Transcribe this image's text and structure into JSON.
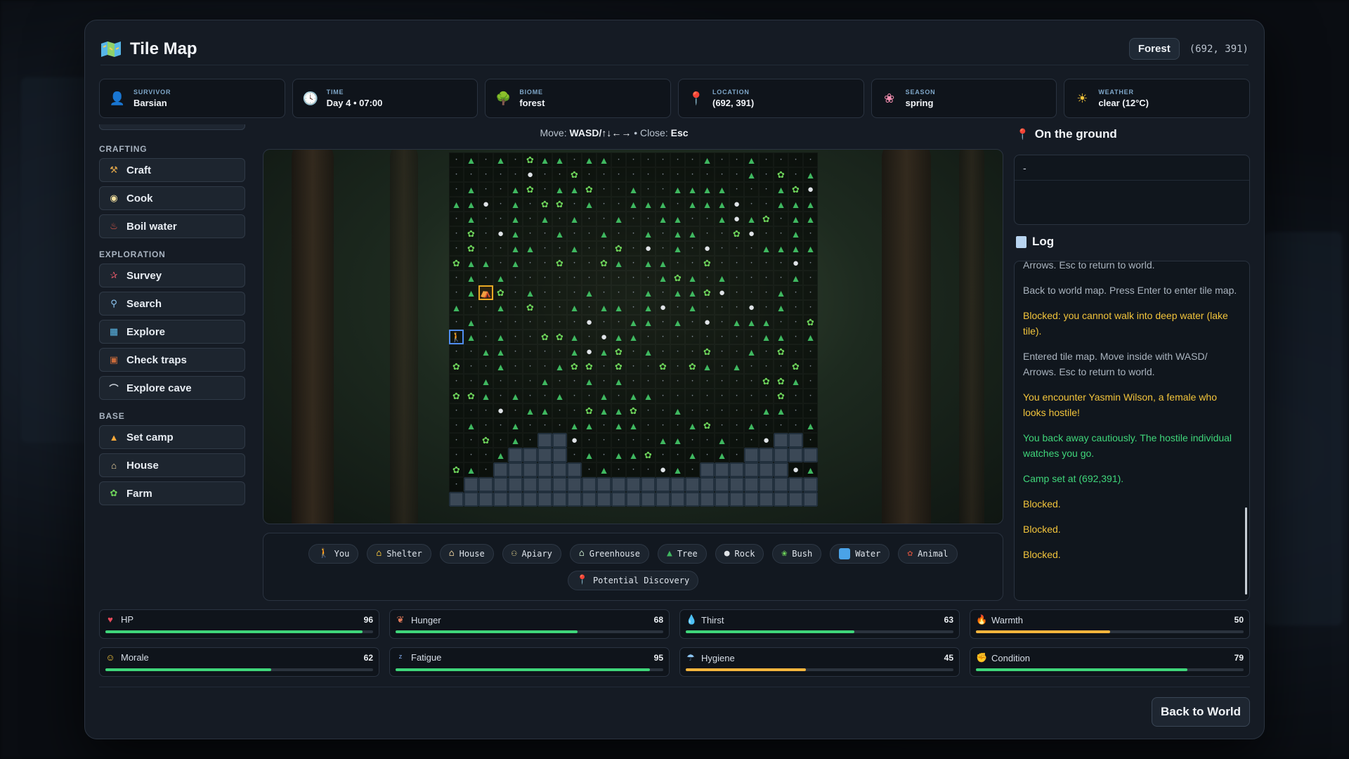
{
  "header": {
    "title": "Tile Map",
    "biome_badge": "Forest",
    "coords": "(692, 391)"
  },
  "info": [
    {
      "label": "SURVIVOR",
      "value": "Barsian",
      "icon": "person-icon"
    },
    {
      "label": "TIME",
      "value": "Day 4 • 07:00",
      "icon": "clock-icon"
    },
    {
      "label": "BIOME",
      "value": "forest",
      "icon": "tree-icon"
    },
    {
      "label": "LOCATION",
      "value": "(692, 391)",
      "icon": "pin-icon"
    },
    {
      "label": "SEASON",
      "value": "spring",
      "icon": "flower-icon"
    },
    {
      "label": "WEATHER",
      "value": "clear (12°C)",
      "icon": "sun-icon"
    }
  ],
  "sidebar": {
    "crafting": {
      "title": "CRAFTING",
      "items": [
        "Craft",
        "Cook",
        "Boil water"
      ]
    },
    "exploration": {
      "title": "EXPLORATION",
      "items": [
        "Survey",
        "Search",
        "Explore",
        "Check traps",
        "Explore cave"
      ]
    },
    "base": {
      "title": "BASE",
      "items": [
        "Set camp",
        "House",
        "Farm"
      ]
    }
  },
  "hint": {
    "move_label": "Move:",
    "move_keys": "WASD/↑↓←→",
    "sep": " •",
    "close_label": "Close:",
    "close_key": "Esc"
  },
  "map": {
    "rows": [
      "..t..t..b.ttt.tt.......t....t..",
      ".......r...b...............t.b",
      "...t..t...bt.ttb..t..tt.ttt.",
      "tb r t r tt.bb.t..ttt.ttt.r t",
      "..tt..t...t.t..t..t...tt..t.r",
      "tb..tt.b.rt..t..t..t.tt..t.tt",
      "br ..t..b..tt...t...b.r.t.r..",
      "....ttttbtt.t..b..bt.tt..t.t",
      "b......r..t.t...........ttb",
      "t.t....t..t.b.t.....t...tt.t",
      "ttbr...t..t..t.b...t.tt.t.t",
      "r.t...r.t...t.........r..tr.",
      "t.t.r.ttt..b...t.t..bbt.t..t",
      "t........tt.t..tt.....tr.t.t",
      "b.t...b..t.b..b.......t..tbb",
      ".b..b.bt.t...b.............t",
      "t.t..........bbt.bbt.r.....t"
    ],
    "grid_compact": [
      "e t e t e b t t e t t e e e e e e t e e t e e e",
      "e e e e e e r e e b e e e e e e e e e e e t e b",
      "e t e t e e t b e t t b e e t e e t t t t e e e",
      "t b r t t r e t e b b e t e e t t t e t t t r e",
      "e t t t e t e e t e t e t e e t e e t t e e t r",
      "t b e t t e b e r t e e t e e t e e t e t t e e",
      "b r e e t e e b e e t t e e t e e b e r e t e r",
      "e e e t t t t b t t e t e e b e e b t e t t e e",
      "b e e e e e r e e t e t e e e e e e e e e e t b",
      "t e t e e e e t e e t C b e t e e e t e e e t e",
      "t t b r e e e t e e t e e t e b e e t e t t e t",
      "r e t e e e r e t e e e t e e e e e e e r e e t",
      "t e t e r e t t t e e b Y t e t e e b b t e r t",
      "t e e e e e e e e t t e t e e t t e e e e t r t",
      "b e t e e e b e e t e b e e b e e t e e e t b b",
      "e b e e b e b t e t e e e b e e e t e e e t e e",
      "t e t e e e e e e e e e b b t e b b t e t e e t",
      "e e t e t t e e e e e e e e b e e e e e r e t t",
      "e e b t t b e e t e e e e e t t e e e t e e t e",
      "e e t t e t t e e e t b e e t e e e t e e b e t",
      "e w w r e e e e e t t e e t e e r w w e e e e t",
      "w w w w e t e t t b e e t e t e w w w w w b t e",
      "w w w w w w e t e e e r t e w w w w w w r t e w",
      "w w w w w w w w w w w w w w w w w w w w w w w w",
      "w w w w w w w w w w w w w w w w w w w w w w w w"
    ]
  },
  "legend": [
    {
      "label": "You",
      "icon": "person-icon"
    },
    {
      "label": "Shelter",
      "icon": "shelter-icon"
    },
    {
      "label": "House",
      "icon": "house-icon"
    },
    {
      "label": "Apiary",
      "icon": "apiary-icon"
    },
    {
      "label": "Greenhouse",
      "icon": "greenhouse-icon"
    },
    {
      "label": "Tree",
      "icon": "tree-icon"
    },
    {
      "label": "Rock",
      "icon": "rock-icon"
    },
    {
      "label": "Bush",
      "icon": "bush-icon"
    },
    {
      "label": "Water",
      "icon": "water-swatch"
    },
    {
      "label": "Animal",
      "icon": "animal-icon"
    },
    {
      "label": "Potential Discovery",
      "icon": "pin-icon"
    }
  ],
  "ground": {
    "title": "On the ground",
    "empty": "-"
  },
  "log": {
    "title": "Log",
    "entries": [
      {
        "text": "Arrows. Esc to return to world.",
        "tone": "gray"
      },
      {
        "text": "Back to world map. Press Enter to enter tile map.",
        "tone": "gray"
      },
      {
        "text": "Blocked: you cannot walk into deep water (lake tile).",
        "tone": "yellow"
      },
      {
        "text": "Entered tile map. Move inside with WASD/ Arrows. Esc to return to world.",
        "tone": "gray"
      },
      {
        "text": "You encounter Yasmin Wilson, a female who looks hostile!",
        "tone": "yellow"
      },
      {
        "text": "You back away cautiously. The hostile individual watches you go.",
        "tone": "green"
      },
      {
        "text": "Camp set at (692,391).",
        "tone": "green"
      },
      {
        "text": "Blocked.",
        "tone": "yellow"
      },
      {
        "text": "Blocked.",
        "tone": "yellow"
      },
      {
        "text": "Blocked.",
        "tone": "yellow"
      }
    ]
  },
  "stats": [
    {
      "label": "HP",
      "value": 96,
      "icon": "heart-icon",
      "color": "#3fd67a"
    },
    {
      "label": "Hunger",
      "value": 68,
      "icon": "meat-icon",
      "color": "#3fd67a"
    },
    {
      "label": "Thirst",
      "value": 63,
      "icon": "droplet-icon",
      "color": "#3fd67a"
    },
    {
      "label": "Warmth",
      "value": 50,
      "icon": "fire-icon",
      "color": "#f5b53d"
    },
    {
      "label": "Morale",
      "value": 62,
      "icon": "smile-icon",
      "color": "#3fd67a"
    },
    {
      "label": "Fatigue",
      "value": 95,
      "icon": "sleep-icon",
      "color": "#3fd67a"
    },
    {
      "label": "Hygiene",
      "value": 45,
      "icon": "shower-icon",
      "color": "#f5b53d"
    },
    {
      "label": "Condition",
      "value": 79,
      "icon": "muscle-icon",
      "color": "#3fd67a"
    }
  ],
  "back_button": "Back to World"
}
